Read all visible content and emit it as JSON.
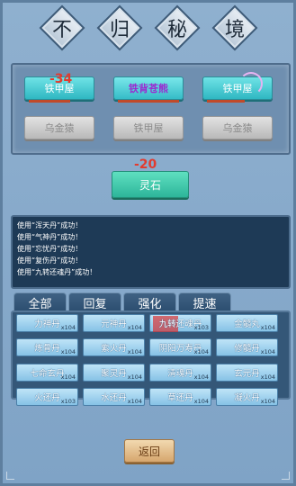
{
  "title": {
    "chars": [
      "不",
      "归",
      "秘",
      "境"
    ]
  },
  "top_buttons": [
    {
      "label": "铁甲屋",
      "style": "teal",
      "damage": "-34"
    },
    {
      "label": "铁背苍熊",
      "style": "purple"
    },
    {
      "label": "铁甲屋",
      "style": "teal"
    },
    {
      "label": "乌金猿",
      "style": "grey"
    },
    {
      "label": "铁甲屋",
      "style": "grey"
    },
    {
      "label": "乌金猿",
      "style": "grey"
    }
  ],
  "coin_button": {
    "label": "灵石",
    "damage": "-20"
  },
  "log": [
    "使用“浑天丹”成功！",
    "使用“气神丹”成功！",
    "使用“忘忧丹”成功！",
    "使用“复伤丹”成功！",
    "使用“九转还魂丹”成功！"
  ],
  "tabs": [
    "全部",
    "回复",
    "强化",
    "提速"
  ],
  "items": [
    {
      "name": "力神丹",
      "count": "x104"
    },
    {
      "name": "元神丹",
      "count": "x104"
    },
    {
      "name": "九转还魂丹",
      "count": "x103",
      "selected": true
    },
    {
      "name": "金髓丸",
      "count": "x104"
    },
    {
      "name": "炼骨丹",
      "count": "x104"
    },
    {
      "name": "紫火丹",
      "count": "x104"
    },
    {
      "name": "阴阳万寿丹",
      "count": "x104"
    },
    {
      "name": "修髓丹",
      "count": "x104"
    },
    {
      "name": "七命玄丹",
      "count": "x104"
    },
    {
      "name": "聚灵丹",
      "count": "x104"
    },
    {
      "name": "清魂丹",
      "count": "x104"
    },
    {
      "name": "玄元丹",
      "count": "x104"
    },
    {
      "name": "火还丹",
      "count": "x103"
    },
    {
      "name": "水还丹",
      "count": "x104"
    },
    {
      "name": "草还丹",
      "count": "x104"
    },
    {
      "name": "凝火丹",
      "count": "x104"
    }
  ],
  "back_button": {
    "label": "返回"
  }
}
